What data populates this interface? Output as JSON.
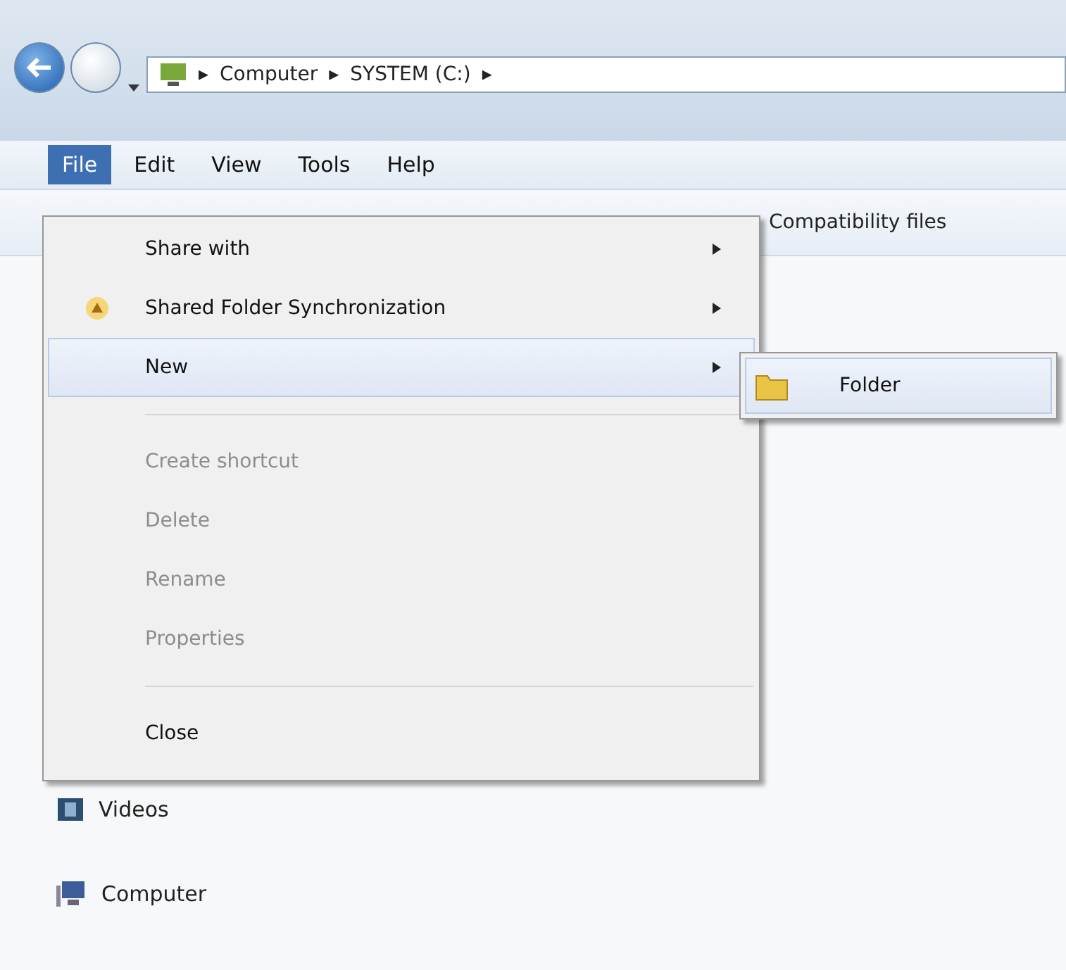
{
  "address_bar": {
    "crumbs": [
      "Computer",
      "SYSTEM (C:)"
    ],
    "separator": "▸"
  },
  "menu_bar": [
    {
      "label": "File",
      "selected": true
    },
    {
      "label": "Edit",
      "selected": false
    },
    {
      "label": "View",
      "selected": false
    },
    {
      "label": "Tools",
      "selected": false
    },
    {
      "label": "Help",
      "selected": false
    }
  ],
  "toolbar": {
    "label": "Compatibility files"
  },
  "file_menu": [
    {
      "kind": "item",
      "label": "Share with",
      "submenu": true,
      "icon": false,
      "disabled": false,
      "selected": false
    },
    {
      "kind": "item",
      "label": "Shared Folder Synchronization",
      "submenu": true,
      "icon": true,
      "disabled": false,
      "selected": false
    },
    {
      "kind": "item",
      "label": "New",
      "submenu": true,
      "icon": false,
      "disabled": false,
      "selected": true
    },
    {
      "kind": "separator"
    },
    {
      "kind": "item",
      "label": "Create shortcut",
      "submenu": false,
      "icon": false,
      "disabled": true,
      "selected": false
    },
    {
      "kind": "item",
      "label": "Delete",
      "submenu": false,
      "icon": false,
      "disabled": true,
      "selected": false
    },
    {
      "kind": "item",
      "label": "Rename",
      "submenu": false,
      "icon": false,
      "disabled": true,
      "selected": false
    },
    {
      "kind": "item",
      "label": "Properties",
      "submenu": false,
      "icon": false,
      "disabled": true,
      "selected": false
    },
    {
      "kind": "separator"
    },
    {
      "kind": "item",
      "label": "Close",
      "submenu": false,
      "icon": false,
      "disabled": false,
      "selected": false
    }
  ],
  "new_submenu": [
    {
      "label": "Folder"
    }
  ],
  "nav_pane": [
    {
      "label": "Videos",
      "kind": "videos"
    },
    {
      "label": "Computer",
      "kind": "computer"
    }
  ]
}
